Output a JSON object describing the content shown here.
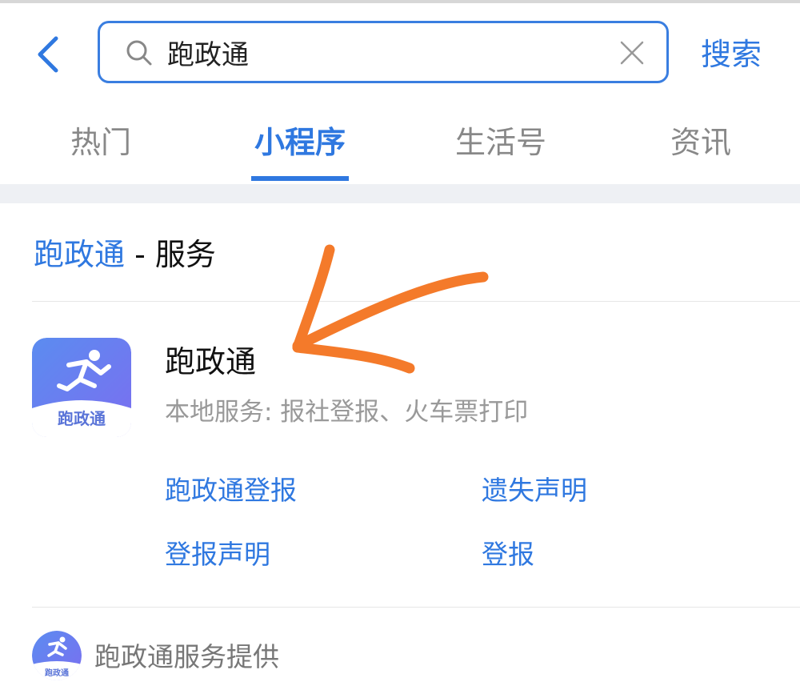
{
  "header": {
    "back_icon": "chevron-left-icon",
    "search_value": "跑政通",
    "search_label": "搜索"
  },
  "tabs": [
    {
      "label": "热门",
      "active": false
    },
    {
      "label": "小程序",
      "active": true
    },
    {
      "label": "生活号",
      "active": false
    },
    {
      "label": "资讯",
      "active": false
    }
  ],
  "section": {
    "keyword": "跑政通",
    "dash": " - ",
    "suffix": "服务"
  },
  "app": {
    "name": "跑政通",
    "description": "本地服务: 报社登报、火车票打印",
    "logo_text": "跑政通"
  },
  "services": [
    {
      "label": "跑政通登报"
    },
    {
      "label": "遗失声明"
    },
    {
      "label": "登报声明"
    },
    {
      "label": "登报"
    }
  ],
  "footer": {
    "provider": "跑政通服务提供",
    "logo_text": "跑政通"
  },
  "colors": {
    "accent": "#2f78e0",
    "annotation": "#f47a2a"
  }
}
